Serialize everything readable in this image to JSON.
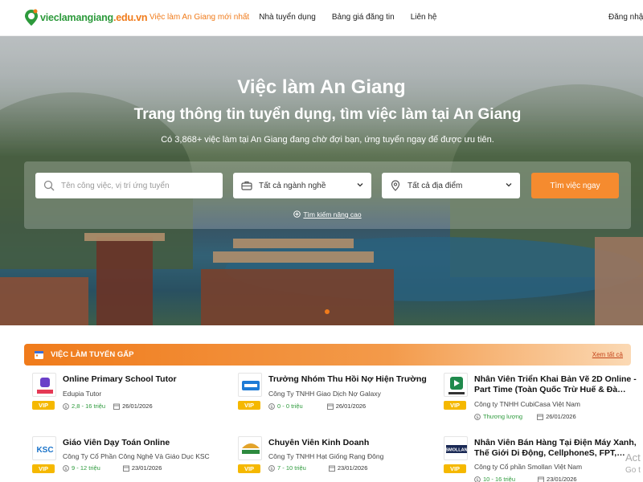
{
  "header": {
    "logo_text_1": "vieclam",
    "logo_text_2": "angiang",
    "logo_text_3": ".edu.vn",
    "nav": [
      {
        "label": "Việc làm An Giang mới nhất",
        "active": true
      },
      {
        "label": "Nhà tuyển dụng",
        "active": false
      },
      {
        "label": "Bảng giá đăng tin",
        "active": false
      },
      {
        "label": "Liên hệ",
        "active": false
      }
    ],
    "login_label": "Đăng nhập",
    "colors": {
      "accent": "#f07b1b",
      "brand_green": "#2d9a3c"
    }
  },
  "hero": {
    "title": "Việc làm An Giang",
    "subtitle": "Trang thông tin tuyển dụng, tìm việc làm tại An Giang",
    "description": "Có 3,868+ việc làm tại An Giang đang chờ đợi bạn, ứng tuyển ngay để được ưu tiên.",
    "search": {
      "keyword_placeholder": "Tên công việc, vị trí ứng tuyển",
      "career_value": "Tất cả ngành nghề",
      "location_value": "Tất cả địa điểm",
      "button_label": "Tìm việc ngay",
      "advanced_label": "Tìm kiếm nâng cao"
    }
  },
  "urgent": {
    "title": "VIỆC LÀM TUYỂN GẤP",
    "see_all": "Xem tất cả",
    "jobs": [
      {
        "title": "Online Primary School Tutor",
        "company": "Edupia Tutor",
        "salary": "2,8 - 16 triệu",
        "date": "26/01/2026",
        "badge": "VIP",
        "logo": "edupia-logo"
      },
      {
        "title": "Trưởng Nhóm Thu Hồi Nợ Hiện Trường",
        "company": "Công Ty TNHH Giao Dịch Nợ Galaxy",
        "salary": "0 - 0 triệu",
        "date": "26/01/2026",
        "badge": "VIP",
        "logo": "galaxy-logo"
      },
      {
        "title": "Nhân Viên Triển Khai Bản Vẽ 2D Online - Part Time (Toàn Quốc Trừ Huế & Đà…",
        "company": "Công ty TNHH CubiCasa Việt Nam",
        "salary": "Thương lượng",
        "date": "26/01/2026",
        "badge": "VIP",
        "logo": "cubicasa-logo"
      },
      {
        "title": "Giáo Viên Dạy Toán Online",
        "company": "Công Ty Cổ Phần Công Nghệ Và Giáo Dục KSC",
        "salary": "9 - 12 triệu",
        "date": "23/01/2026",
        "badge": "VIP",
        "logo": "ksc-logo"
      },
      {
        "title": "Chuyên Viên Kinh Doanh",
        "company": "Công Ty TNHH Hạt Giống Rạng Đông",
        "salary": "7 - 10 triệu",
        "date": "23/01/2026",
        "badge": "VIP",
        "logo": "rang-dong-logo"
      },
      {
        "title": "Nhân Viên Bán Hàng Tại Điện Máy Xanh, Thế Giới Di Động, CellphoneS, FPT,…",
        "company": "Công ty Cổ phần Smollan Việt Nam",
        "salary": "10 - 16 triệu",
        "date": "23/01/2026",
        "badge": "VIP",
        "logo": "smollan-logo"
      }
    ]
  },
  "watermark": {
    "line1": "Act",
    "line2": "Go t"
  }
}
